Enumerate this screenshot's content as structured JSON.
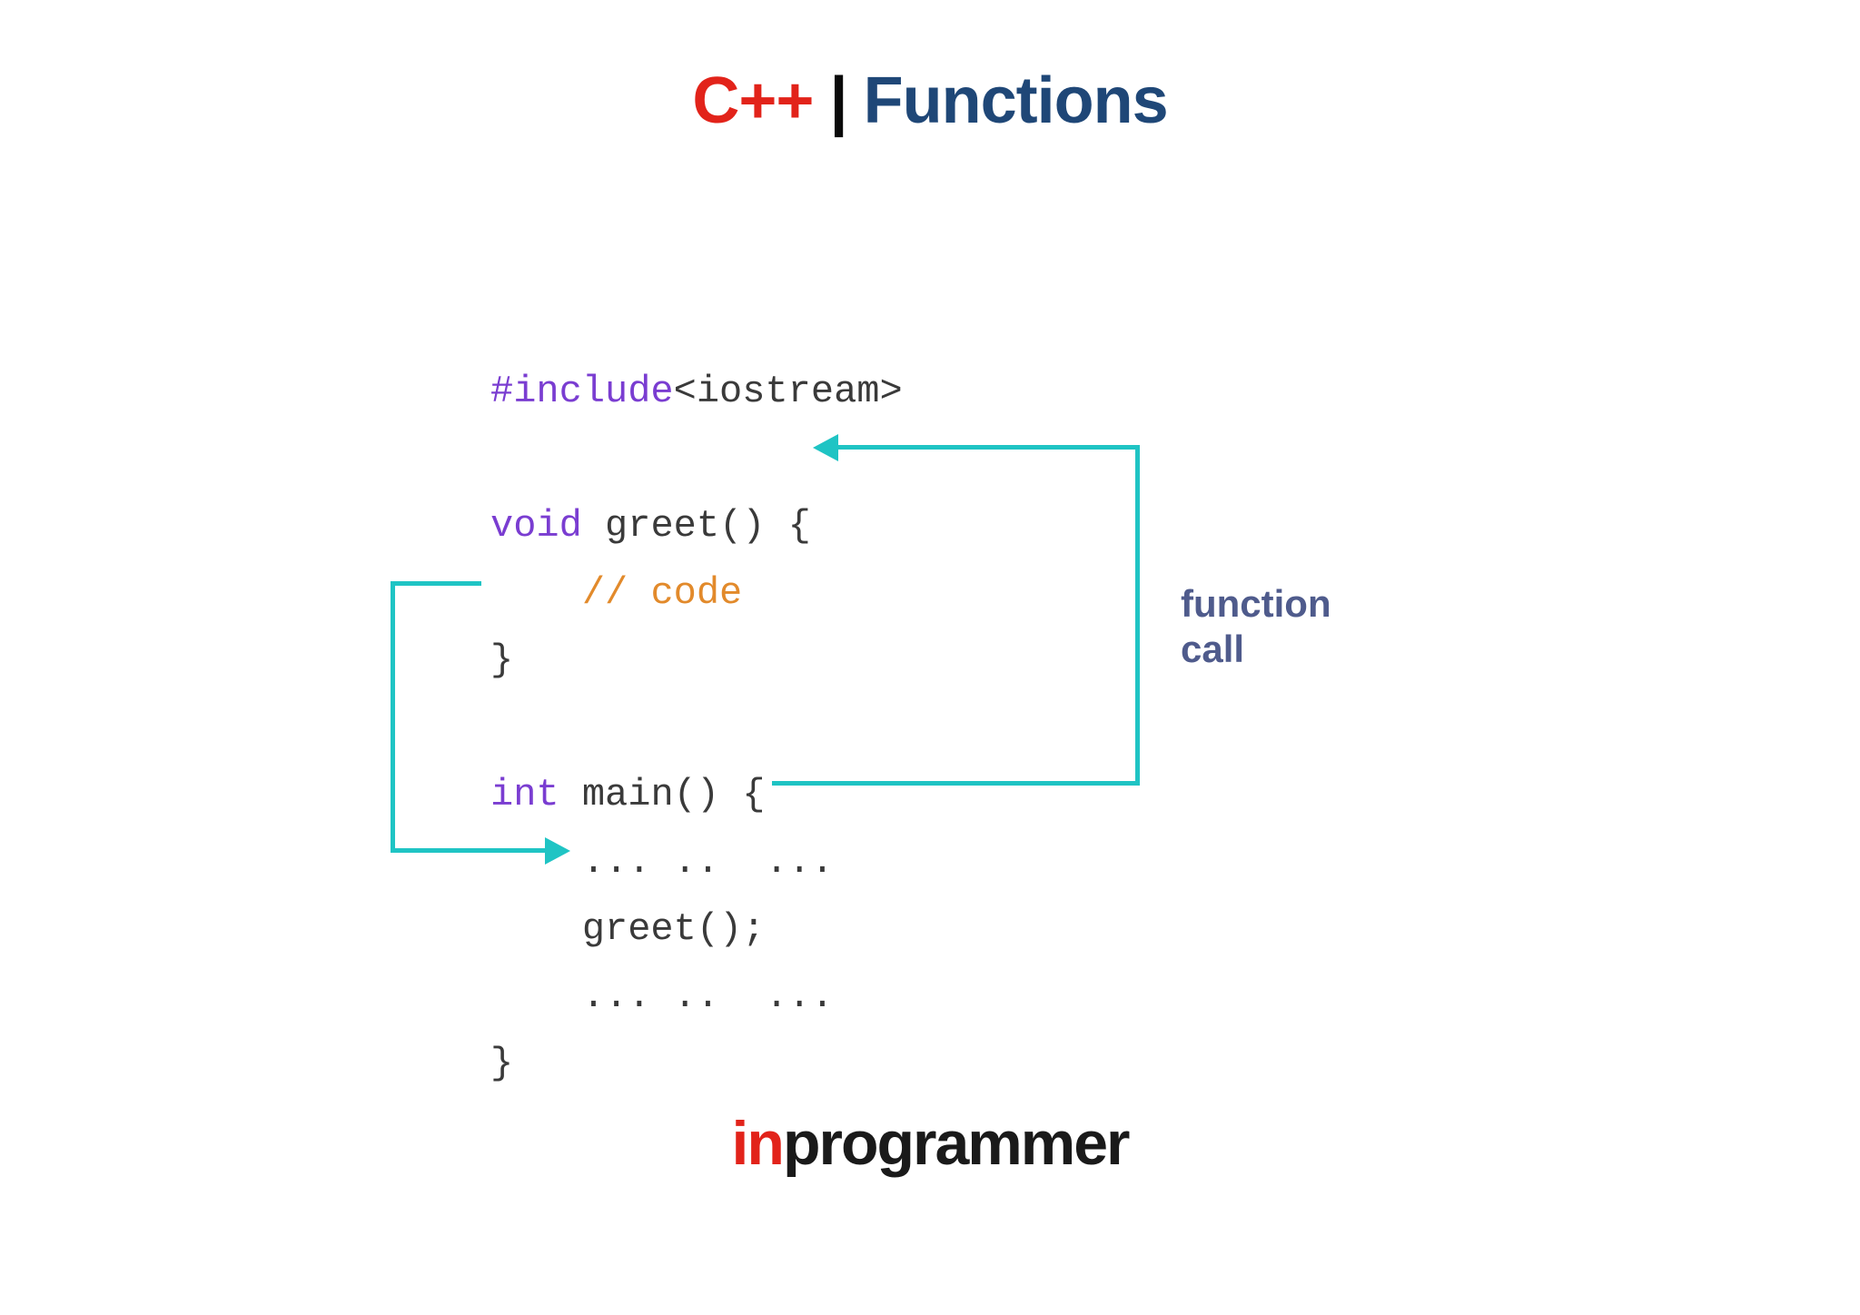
{
  "title": {
    "left": "C++",
    "pipe": "|",
    "right": "Functions"
  },
  "code": {
    "line1_kw": "#include",
    "line1_rest": "<iostream>",
    "line3_kw": "void",
    "line3_rest": " greet() {",
    "line4_indent": "    ",
    "line4_comment": "// code",
    "line5": "}",
    "line7_kw": "int",
    "line7_rest": " main() {",
    "line8": "    ... ..  ...",
    "line9": "    greet();",
    "line10": "    ... ..  ...",
    "line11": "}"
  },
  "annotation": {
    "line1": "function",
    "line2": "call"
  },
  "footer": {
    "prefix": "in",
    "rest": "programmer"
  },
  "colors": {
    "arrow": "#1fc4c4",
    "title_red": "#e2231a",
    "title_blue": "#1f4777",
    "code_purple": "#7a3dd1",
    "code_orange": "#e28a2b",
    "annot": "#4f5b8c"
  }
}
